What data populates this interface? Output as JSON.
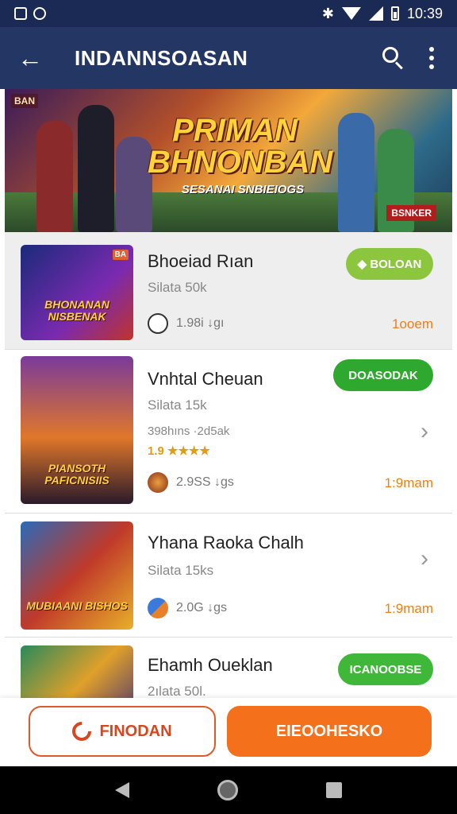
{
  "status_bar": {
    "time": "10:39"
  },
  "app_bar": {
    "title": "INDANNSOASAN"
  },
  "banner": {
    "corner_label": "BAN",
    "title_line1": "PRIMAN",
    "title_line2": "BHNONBAN",
    "subtitle": "SESANAI SNBIEIOGS",
    "badge": "BSNKER"
  },
  "games": [
    {
      "name": "Bhoeiad Rıan",
      "subtitle": "Silata 50k",
      "thumb_text": "BHONANAN NISBENAK",
      "thumb_tag": "BA",
      "downloads": "1.98i ↓gı",
      "size": "1ooem",
      "action_label": "◆ BOLOAN",
      "action_color": "#8cc63f"
    },
    {
      "name": "Vnhtal Cheuan",
      "subtitle": "Silata 15k",
      "meta": "398hıns ·2d5ak",
      "rating": "1.9",
      "stars": "★★★★",
      "thumb_text": "PIANSOTH PAFICNISIIS",
      "downloads": "2.9SS ↓gs",
      "size": "1:9mam",
      "action_label": "DOASODAK",
      "action_color": "#2ea82e"
    },
    {
      "name": "Yhana Raoka Chalh",
      "subtitle": "Silata 15ks",
      "thumb_text": "MUBIAANI BISHOS",
      "downloads": "2.0G ↓gs",
      "size": "1:9mam"
    },
    {
      "name": "Ehamh Oueklan",
      "subtitle": "2ılata 50l.",
      "thumb_text": "",
      "action_label": "ICANOOBSE",
      "action_color": "#3fb83a"
    }
  ],
  "bottom": {
    "left_button": "FINODAN",
    "right_button": "EIEOOHESKO"
  },
  "icons": [
    "back-arrow-icon",
    "search-icon",
    "more-vert-icon",
    "chevron-right-icon",
    "refresh-icon",
    "nav-back-icon",
    "nav-home-icon",
    "nav-recent-icon"
  ]
}
